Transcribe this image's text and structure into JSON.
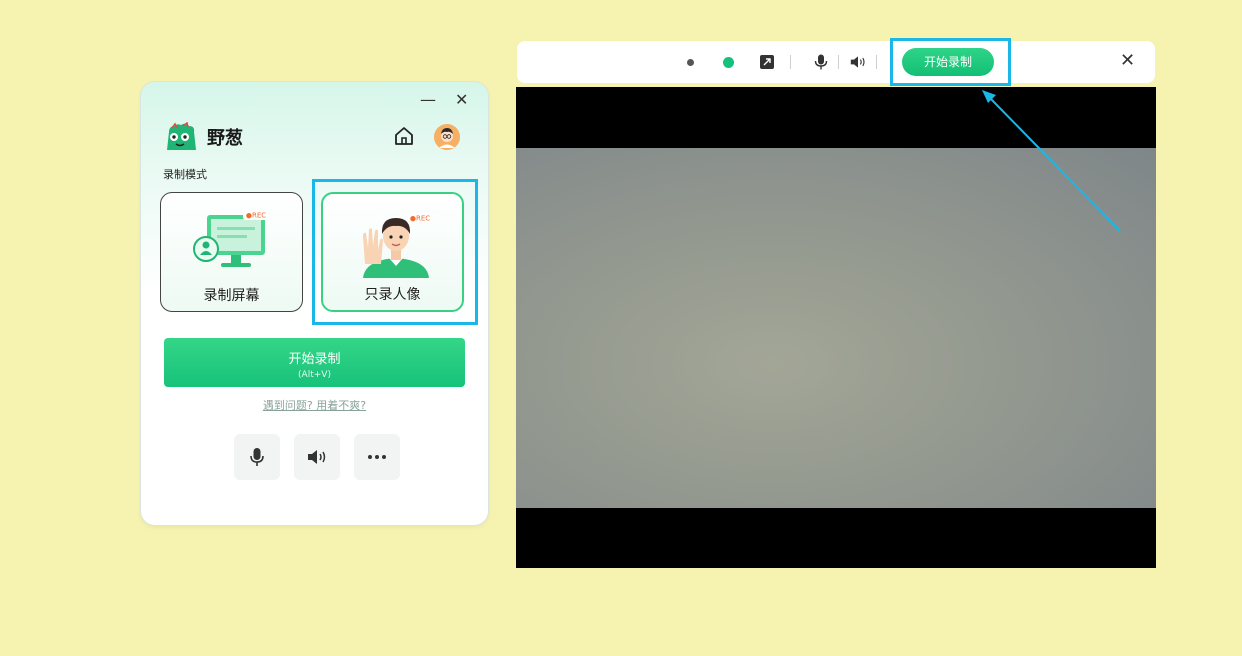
{
  "panel": {
    "brand_name": "野葱",
    "mode_label": "录制模式",
    "window_minimize": "—",
    "window_close": "✕",
    "modes": [
      {
        "label": "录制屏幕",
        "badge": "●REC",
        "selected": false
      },
      {
        "label": "只录人像",
        "badge": "●REC",
        "selected": true
      }
    ],
    "start_button": {
      "label": "开始录制",
      "shortcut": "(Alt+V)"
    },
    "help_link": "遇到问题? 用着不爽?",
    "tools": [
      "microphone-icon",
      "speaker-icon",
      "more-icon"
    ],
    "colors": {
      "accent": "#17c27a",
      "highlight": "#1ab8e8"
    }
  },
  "topbar": {
    "record_button": "开始录制",
    "close": "✕",
    "icons": [
      "dot-small",
      "dot-green",
      "pip-icon",
      "microphone-icon",
      "speaker-icon"
    ]
  },
  "preview": {
    "background": "#000000"
  }
}
